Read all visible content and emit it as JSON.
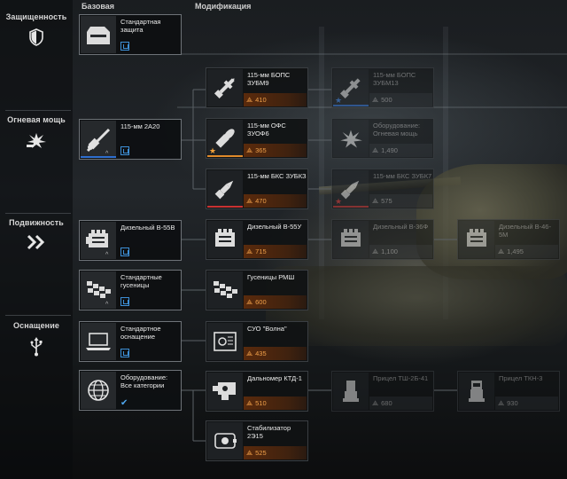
{
  "headers": {
    "base": "Базовая",
    "modification": "Модификация"
  },
  "categories": [
    {
      "label": "Защищенность",
      "icon": "shield-icon"
    },
    {
      "label": "Огневая мощь",
      "icon": "explosion-icon"
    },
    {
      "label": "Подвижность",
      "icon": "chevrons-icon"
    },
    {
      "label": "Оснащение",
      "icon": "usb-icon"
    }
  ],
  "cards": {
    "armor_base": {
      "title": "Стандартная защита",
      "icon": "armor-plate-icon"
    },
    "gun_base": {
      "title": "115-мм 2А20",
      "icon": "gun-icon"
    },
    "shell_bops": {
      "title": "115-мм БОПС ЗУБМ9",
      "price": "410",
      "icon": "apfsds-shell-icon"
    },
    "shell_bops2": {
      "title": "115-мм БОПС ЗУБМ13",
      "price": "500",
      "icon": "apfsds-shell-icon"
    },
    "shell_ofs": {
      "title": "115-мм ОФС ЗУОФ6",
      "price": "365",
      "icon": "he-shell-icon"
    },
    "equip_fire": {
      "title": "Оборудование: Огневая мощь",
      "price": "1,490",
      "icon": "explosion-icon"
    },
    "shell_bks": {
      "title": "115-мм БКС ЗУБКЗ",
      "price": "470",
      "icon": "heat-shell-icon"
    },
    "shell_bks2": {
      "title": "115-мм БКС ЗУБК7",
      "price": "575",
      "icon": "heat-shell-icon"
    },
    "engine_base": {
      "title": "Дизельный В-55В",
      "icon": "engine-icon"
    },
    "engine_u": {
      "title": "Дизельный В-55У",
      "price": "715",
      "icon": "engine-icon"
    },
    "engine_36": {
      "title": "Дизельный В-36Ф",
      "price": "1,100",
      "icon": "engine-icon"
    },
    "engine_46": {
      "title": "Дизельный В-46-5М",
      "price": "1,495",
      "icon": "engine-icon"
    },
    "tracks_base": {
      "title": "Стандартные гусеницы",
      "icon": "tracks-icon"
    },
    "tracks_rmsh": {
      "title": "Гусеницы РМШ",
      "price": "600",
      "icon": "tracks-icon"
    },
    "outfit_base": {
      "title": "Стандартное оснащение",
      "icon": "laptop-icon"
    },
    "suo": {
      "title": "СУО \"Волна\"",
      "price": "435",
      "icon": "fire-control-icon"
    },
    "sight_tsh": {
      "title": "Прицел ТШ-2Б-41",
      "price": "680",
      "icon": "sight-icon"
    },
    "sight_tkn": {
      "title": "Прицел ТКН-3",
      "price": "930",
      "icon": "sight-icon"
    },
    "equip_all": {
      "title": "Оборудование: Все категории",
      "icon": "globe-icon"
    },
    "rangefinder": {
      "title": "Дальномер КТД-1",
      "price": "510",
      "icon": "rangefinder-icon"
    },
    "stabilizer": {
      "title": "Стабилизатор 2Э15",
      "price": "525",
      "icon": "stabilizer-icon"
    }
  },
  "colors": {
    "accent": "#f0a04a",
    "installed": "#3d8fd6",
    "rank_blue": "#2e6fd0",
    "rank_orange": "#e08a2a",
    "rank_red": "#c93232"
  }
}
